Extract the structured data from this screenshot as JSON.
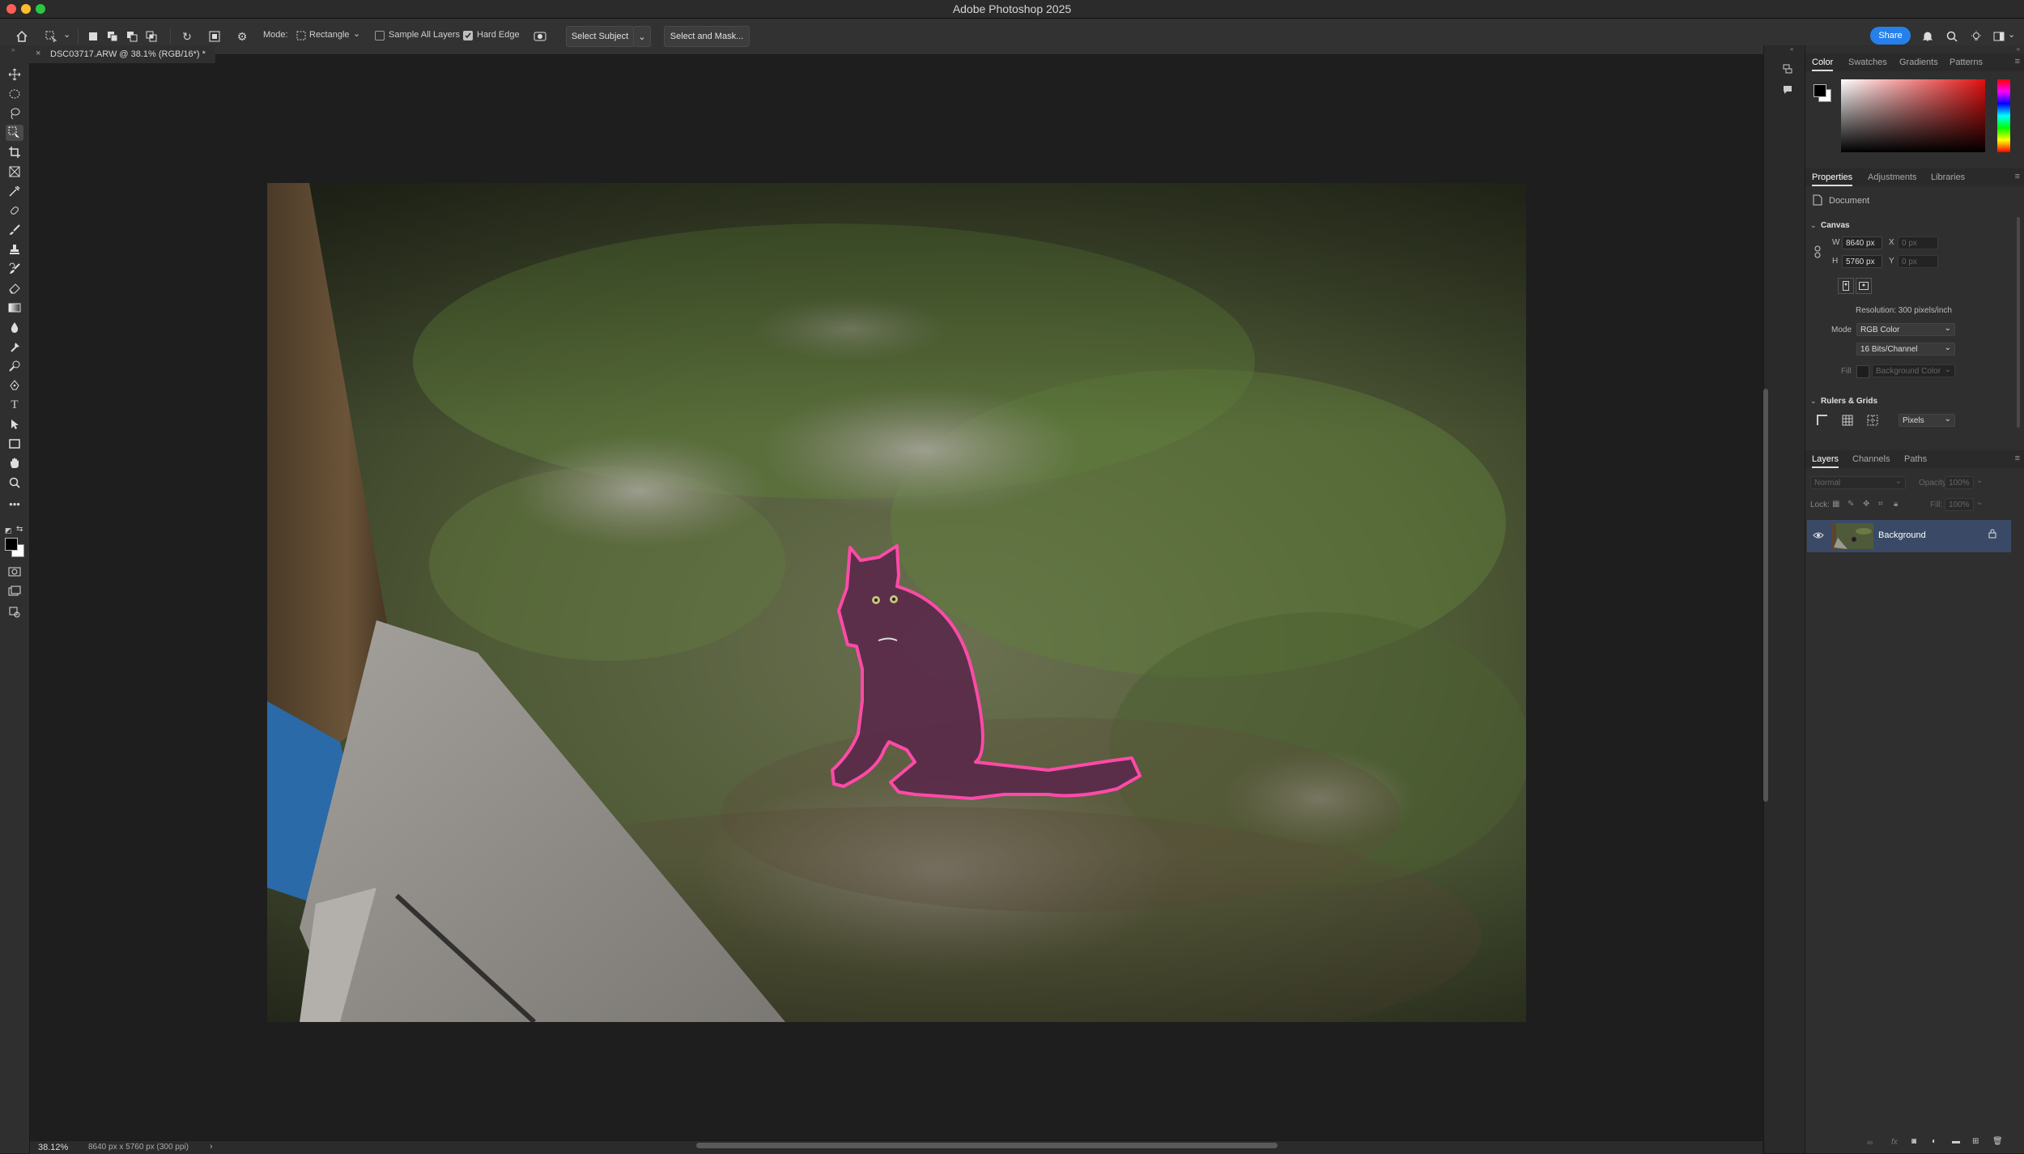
{
  "app": {
    "title": "Adobe Photoshop 2025"
  },
  "options_bar": {
    "mode_label": "Mode:",
    "mode_value": "Rectangle",
    "sample_all_layers": "Sample All Layers",
    "sample_all_layers_checked": false,
    "hard_edge": "Hard Edge",
    "hard_edge_checked": true,
    "select_subject": "Select Subject",
    "select_and_mask": "Select and Mask...",
    "share": "Share"
  },
  "document_tab": {
    "close": "×",
    "title": "DSC03717.ARW @ 38.1% (RGB/16*) *"
  },
  "color_panel": {
    "tabs": [
      "Color",
      "Swatches",
      "Gradients",
      "Patterns"
    ],
    "active_tab": "Color"
  },
  "properties_panel": {
    "tabs": [
      "Properties",
      "Adjustments",
      "Libraries"
    ],
    "active_tab": "Properties",
    "document_label": "Document",
    "canvas_section": "Canvas",
    "w_label": "W",
    "w_value": "8640 px",
    "h_label": "H",
    "h_value": "5760 px",
    "x_label": "X",
    "x_value": "0 px",
    "y_label": "Y",
    "y_value": "0 px",
    "resolution": "Resolution: 300 pixels/inch",
    "mode_label": "Mode",
    "mode_value": "RGB Color",
    "bits_value": "16 Bits/Channel",
    "fill_label": "Fill",
    "fill_value": "Background Color",
    "rulers_section": "Rulers & Grids",
    "units_value": "Pixels"
  },
  "layers_panel": {
    "tabs": [
      "Layers",
      "Channels",
      "Paths"
    ],
    "active_tab": "Layers",
    "blend_mode": "Normal",
    "opacity_label": "Opacity:",
    "opacity_value": "100%",
    "lock_label": "Lock:",
    "fill_label": "Fill:",
    "fill_value": "100%",
    "layers": [
      {
        "name": "Background",
        "visible": true,
        "locked": true,
        "selected": true
      }
    ]
  },
  "status_bar": {
    "zoom": "38.12%",
    "doc_info": "8640 px x 5760 px (300 ppi)",
    "arrow": "›"
  },
  "colors": {
    "accent": "#2680eb",
    "selection_outline": "#ff4aa8",
    "layer_selected": "#3a4a66"
  }
}
